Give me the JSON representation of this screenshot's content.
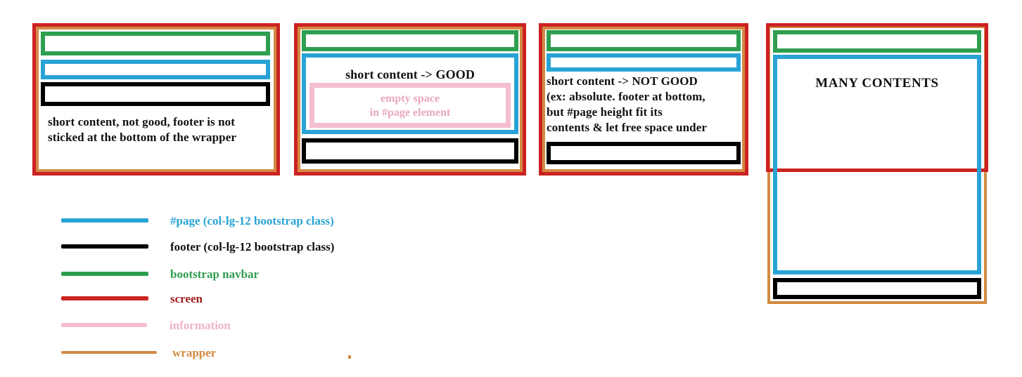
{
  "colors": {
    "page": "#29a3d5",
    "footer": "#000000",
    "navbar": "#2e9e4f",
    "screen": "#cc2222",
    "information": "#f5bdd0",
    "wrapper": "#d38a42",
    "text": "#111111",
    "info_text": "#e8a8bd",
    "background": "#ffffff"
  },
  "panels": [
    {
      "id": "panel-1",
      "note": "short content, not good, footer is not sticked at the bottom of the wrapper",
      "parts": [
        "screen",
        "wrapper",
        "navbar",
        "page",
        "footer"
      ]
    },
    {
      "id": "panel-2",
      "note": "short content -> GOOD",
      "info_note": "empty space\nin #page element",
      "info_note_line_1": "empty space",
      "info_note_line_2": "in #page element",
      "parts": [
        "screen",
        "wrapper",
        "navbar",
        "page",
        "information",
        "footer"
      ]
    },
    {
      "id": "panel-3",
      "note": "short content -> NOT GOOD\n(ex: absolute. footer at bottom,\nbut #page height fit its\ncontents & let free space under",
      "note_line_1": " short content -> NOT GOOD",
      "note_line_2": "(ex: absolute. footer at bottom,",
      "note_line_3": "but #page height fit its",
      "note_line_4": "contents & let free space under",
      "parts": [
        "screen",
        "wrapper",
        "navbar",
        "page",
        "footer"
      ]
    },
    {
      "id": "panel-4",
      "note": "MANY CONTENTS",
      "parts": [
        "screen",
        "wrapper",
        "navbar",
        "page",
        "footer"
      ]
    }
  ],
  "legend": {
    "items": [
      {
        "label": "#page (col-lg-12 bootstrap class)",
        "color": "#29a3d5",
        "key": "page"
      },
      {
        "label": "footer (col-lg-12 bootstrap class)",
        "color": "#000000",
        "key": "footer"
      },
      {
        "label": "bootstrap navbar",
        "color": "#2e9e4f",
        "key": "navbar"
      },
      {
        "label": "screen",
        "color": "#cc2222",
        "key": "screen"
      },
      {
        "label": "information",
        "color": "#f5bdd0",
        "key": "information"
      },
      {
        "label": "wrapper",
        "color": "#d38a42",
        "key": "wrapper"
      }
    ]
  }
}
